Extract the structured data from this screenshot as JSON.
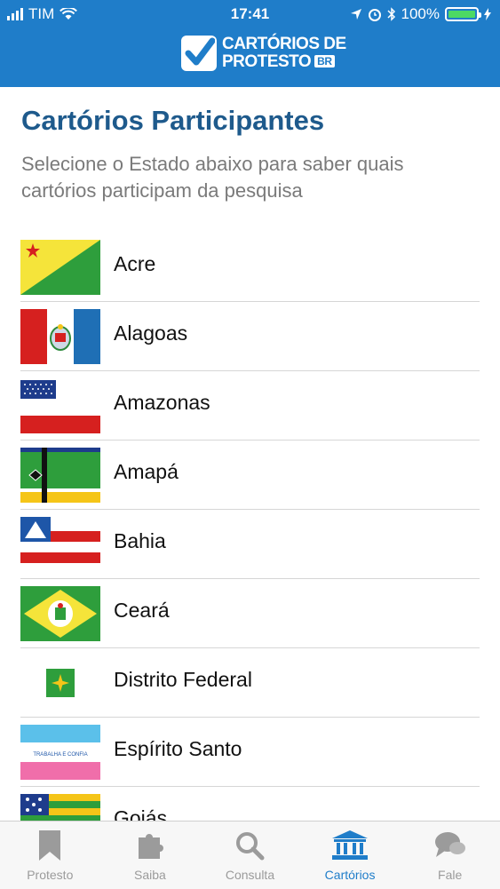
{
  "status": {
    "carrier": "TIM",
    "time": "17:41",
    "battery": "100%",
    "battery_level": 1.0
  },
  "header": {
    "logo_line1": "CARTÓRIOS DE",
    "logo_line2": "PROTESTO",
    "logo_badge": "BR"
  },
  "page": {
    "title": "Cartórios Participantes",
    "subtitle": "Selecione o Estado abaixo para saber quais cartórios participam da pesquisa"
  },
  "states": [
    {
      "name": "Acre"
    },
    {
      "name": "Alagoas"
    },
    {
      "name": "Amazonas"
    },
    {
      "name": "Amapá"
    },
    {
      "name": "Bahia"
    },
    {
      "name": "Ceará"
    },
    {
      "name": "Distrito Federal"
    },
    {
      "name": "Espírito Santo"
    },
    {
      "name": "Goiás"
    }
  ],
  "flag_texts": {
    "espirito_santo_motto": "TRABALHA E CONFIA"
  },
  "tabs": [
    {
      "label": "Protesto",
      "icon": "bookmark-icon"
    },
    {
      "label": "Saiba",
      "icon": "puzzle-icon"
    },
    {
      "label": "Consulta",
      "icon": "search-icon"
    },
    {
      "label": "Cartórios",
      "icon": "building-icon",
      "active": true
    },
    {
      "label": "Fale",
      "icon": "chat-icon"
    }
  ],
  "colors": {
    "primary": "#1f7dc9",
    "title": "#1e5a8c",
    "active_tab": "#1f7dc9",
    "inactive_tab": "#9b9b9b"
  }
}
